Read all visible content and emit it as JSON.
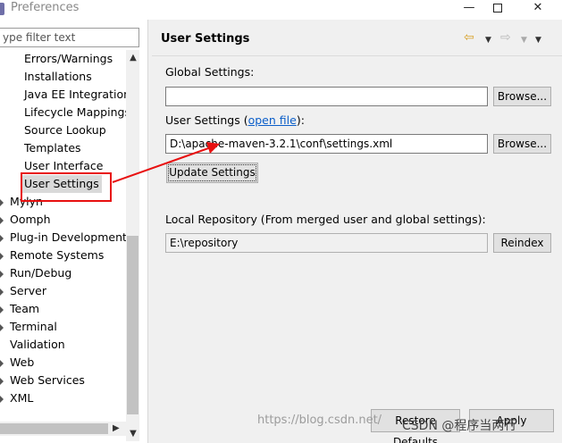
{
  "window": {
    "title": "Preferences",
    "minimize_glyph": "—",
    "close_glyph": "✕"
  },
  "sidebar": {
    "filter_placeholder": "ype filter text",
    "maven_children": [
      "Errors/Warnings",
      "Installations",
      "Java EE Integration",
      "Lifecycle Mappings",
      "Source Lookup",
      "Templates",
      "User Interface",
      "User Settings"
    ],
    "top_items": [
      "Mylyn",
      "Oomph",
      "Plug-in Development",
      "Remote Systems",
      "Run/Debug",
      "Server",
      "Team",
      "Terminal",
      "Validation",
      "Web",
      "Web Services",
      "XML"
    ],
    "selected": "User Settings",
    "scroll_up_glyph": "▲",
    "scroll_down_glyph": "▼",
    "scroll_right_glyph": "▶"
  },
  "page": {
    "title": "User Settings",
    "nav_back_glyph": "⇦",
    "nav_forward_glyph": "⇨",
    "nav_dropdown_glyph": "▼",
    "global_settings_label": "Global Settings:",
    "global_settings_value": "",
    "browse_label": "Browse...",
    "user_settings_label_prefix": "User Settings (",
    "open_file_link": "open file",
    "user_settings_label_suffix": "):",
    "user_settings_value": "D:\\apache-maven-3.2.1\\conf\\settings.xml",
    "update_settings_label": "Update Settings",
    "local_repo_label": "Local Repository (From merged user and global settings):",
    "local_repo_value": "E:\\repository",
    "reindex_label": "Reindex"
  },
  "footer": {
    "restore_defaults": "Restore Defaults",
    "apply": "Apply"
  },
  "watermarks": {
    "blog": "https://blog.csdn.net/",
    "csdn": "CSDN @程序当两行"
  },
  "colors": {
    "annotation": "#e81010",
    "link": "#0b5ec9",
    "panel_bg": "#f0f0f0"
  }
}
